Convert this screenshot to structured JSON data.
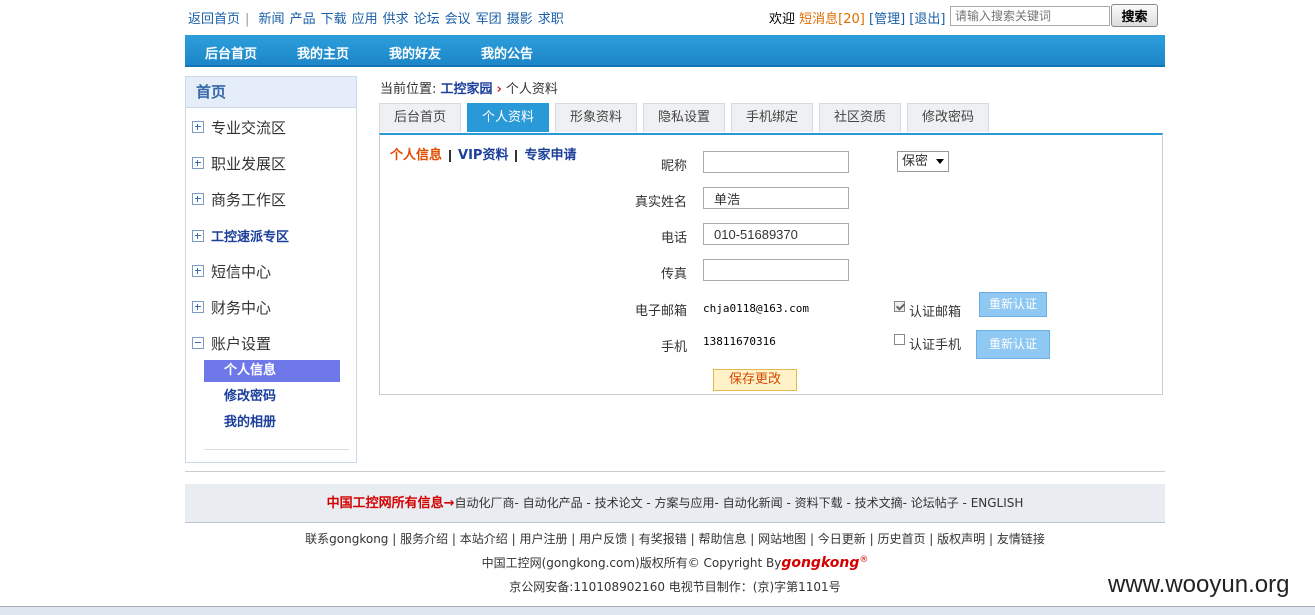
{
  "topbar": {
    "back_home": "返回首页",
    "nav_links": [
      "新闻",
      "产品",
      "下载",
      "应用",
      "供求",
      "论坛",
      "会议",
      "军团",
      "摄影",
      "求职"
    ],
    "welcome": "欢迎",
    "messages": "短消息",
    "message_count": "[20]",
    "manage": "[管理]",
    "logout": "[退出]",
    "search_placeholder": "请输入搜索关键词",
    "search_button": "搜索"
  },
  "mainnav": [
    "后台首页",
    "我的主页",
    "我的好友",
    "我的公告"
  ],
  "sidebar": {
    "header": "首页",
    "items": [
      "专业交流区",
      "职业发展区",
      "商务工作区",
      "工控速派专区",
      "短信中心",
      "财务中心",
      "账户设置"
    ],
    "subitems": [
      "个人信息",
      "修改密码",
      "我的相册"
    ]
  },
  "breadcrumb": {
    "prefix": "当前位置:",
    "home": "工控家园",
    "current": "个人资料"
  },
  "tabs": [
    "后台首页",
    "个人资料",
    "形象资料",
    "隐私设置",
    "手机绑定",
    "社区资质",
    "修改密码"
  ],
  "subtabs": [
    "个人信息",
    "VIP资料",
    "专家申请"
  ],
  "form": {
    "nickname_label": "昵称",
    "nickname_value": "",
    "privacy_select": "保密",
    "realname_label": "真实姓名",
    "realname_value": "单浩",
    "phone_label": "电话",
    "phone_value": "010-51689370",
    "fax_label": "传真",
    "fax_value": "",
    "email_label": "电子邮箱",
    "email_value": "chja0118@163.com",
    "verify_email_label": "认证邮箱",
    "reverify_label": "重新认证",
    "mobile_label": "手机",
    "mobile_value": "13811670316",
    "verify_mobile_label": "认证手机",
    "save_button": "保存更改"
  },
  "footer": {
    "red_label": "中国工控网所有信息→",
    "categories": "自动化厂商- 自动化产品 - 技术论文 - 方案与应用- 自动化新闻 - 资料下载 - 技术文摘- 论坛帖子 - ENGLISH",
    "links_line": "联系gongkong | 服务介绍 | 本站介绍 | 用户注册 | 用户反馈 | 有奖报错 | 帮助信息 | 网站地图 | 今日更新 | 历史首页 | 版权声明 | 友情链接",
    "copyright": "中国工控网(gongkong.com)版权所有© Copyright By",
    "brand": "gongkong",
    "brand_mark": "®",
    "license": "京公网安备:110108902160   电视节目制作：(京)字第1101号"
  },
  "watermark": "www.wooyun.org"
}
